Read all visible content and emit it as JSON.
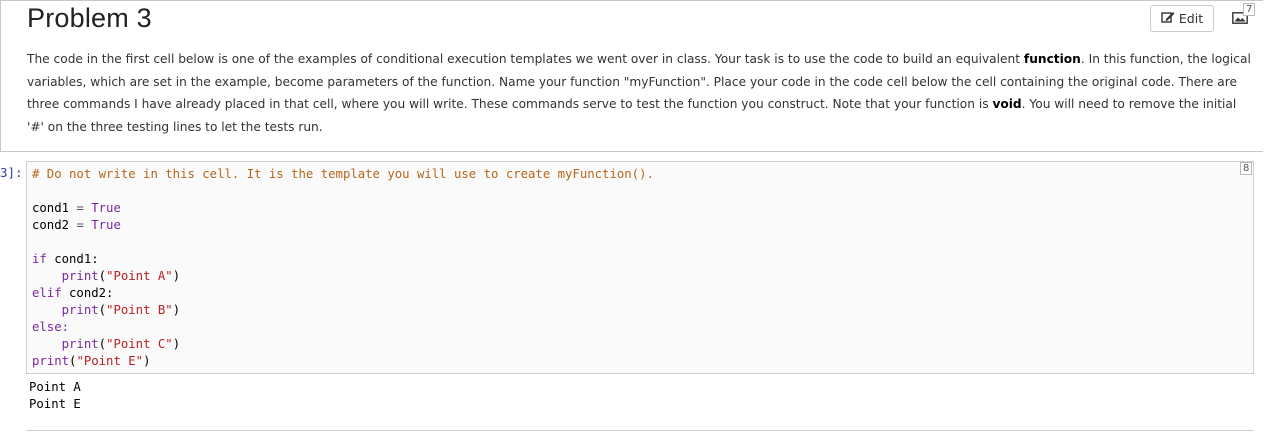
{
  "markdown_cell": {
    "title": "Problem 3",
    "edit_label": "Edit",
    "cell_number": "7",
    "para_1": "The code in the first cell below is one of the examples of conditional execution templates we went over in class. Your task is to use the code to build an equivalent ",
    "para_bold_function": "function",
    "para_2": ". In this function, the logical variables, which are set in the example, become parameters of the function. Name your function \"myFunction\". Place your code in the code cell below the cell containing the original code. There are three commands I have already placed in that cell, where you will write. These commands serve to test the function you construct. Note that your function is ",
    "para_bold_void": "void",
    "para_3": ". You will need to remove the initial '#' on the three testing lines to let the tests run."
  },
  "code_cell": {
    "prompt": "3]:",
    "cell_number": "8",
    "comment": "# Do not write in this cell. It is the template you will use to create myFunction().",
    "line_cond1_var": "cond1",
    "line_cond2_var": "cond2",
    "eq": "=",
    "true_kw": "True",
    "if_kw": "if",
    "if_cond": "cond1:",
    "elif_kw": "elif",
    "elif_cond": "cond2:",
    "else_kw": "else:",
    "print_kw": "print",
    "str_a": "\"Point A\"",
    "str_b": "\"Point B\"",
    "str_c": "\"Point C\"",
    "str_e": "\"Point E\""
  },
  "output": {
    "line_1": "Point A",
    "line_2": "Point E"
  }
}
